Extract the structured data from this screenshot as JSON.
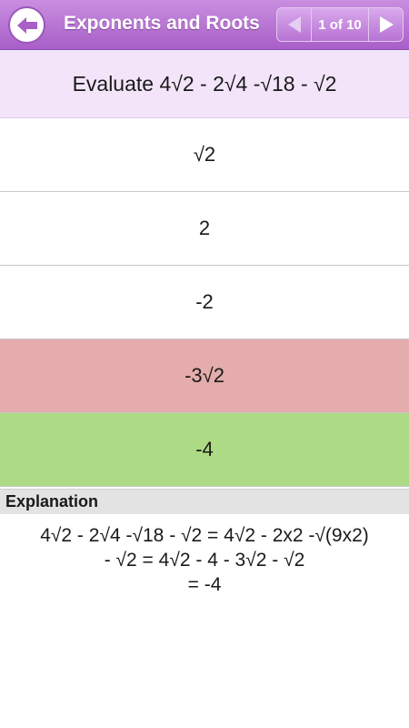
{
  "header": {
    "title": "Exponents and Roots",
    "pager_label": "1 of 10",
    "back_icon": "arrow-left-icon",
    "prev_icon": "triangle-left-icon",
    "next_icon": "triangle-right-icon"
  },
  "question": {
    "text": "Evaluate 4√2 - 2√4 -√18 - √2"
  },
  "answers": [
    {
      "label": "√2",
      "state": "neutral"
    },
    {
      "label": "2",
      "state": "neutral"
    },
    {
      "label": "-2",
      "state": "neutral"
    },
    {
      "label": "-3√2",
      "state": "wrong"
    },
    {
      "label": "-4",
      "state": "correct"
    }
  ],
  "explanation": {
    "heading": "Explanation",
    "lines": [
      "4√2 - 2√4 -√18 - √2 = 4√2 - 2x2 -√(9x2)",
      "- √2 = 4√2 - 4 - 3√2 - √2",
      "= -4"
    ]
  },
  "colors": {
    "header_accent": "#a85fc7",
    "question_bg": "#f3e4fa",
    "wrong_bg": "#e4acac",
    "correct_bg": "#addb85"
  }
}
